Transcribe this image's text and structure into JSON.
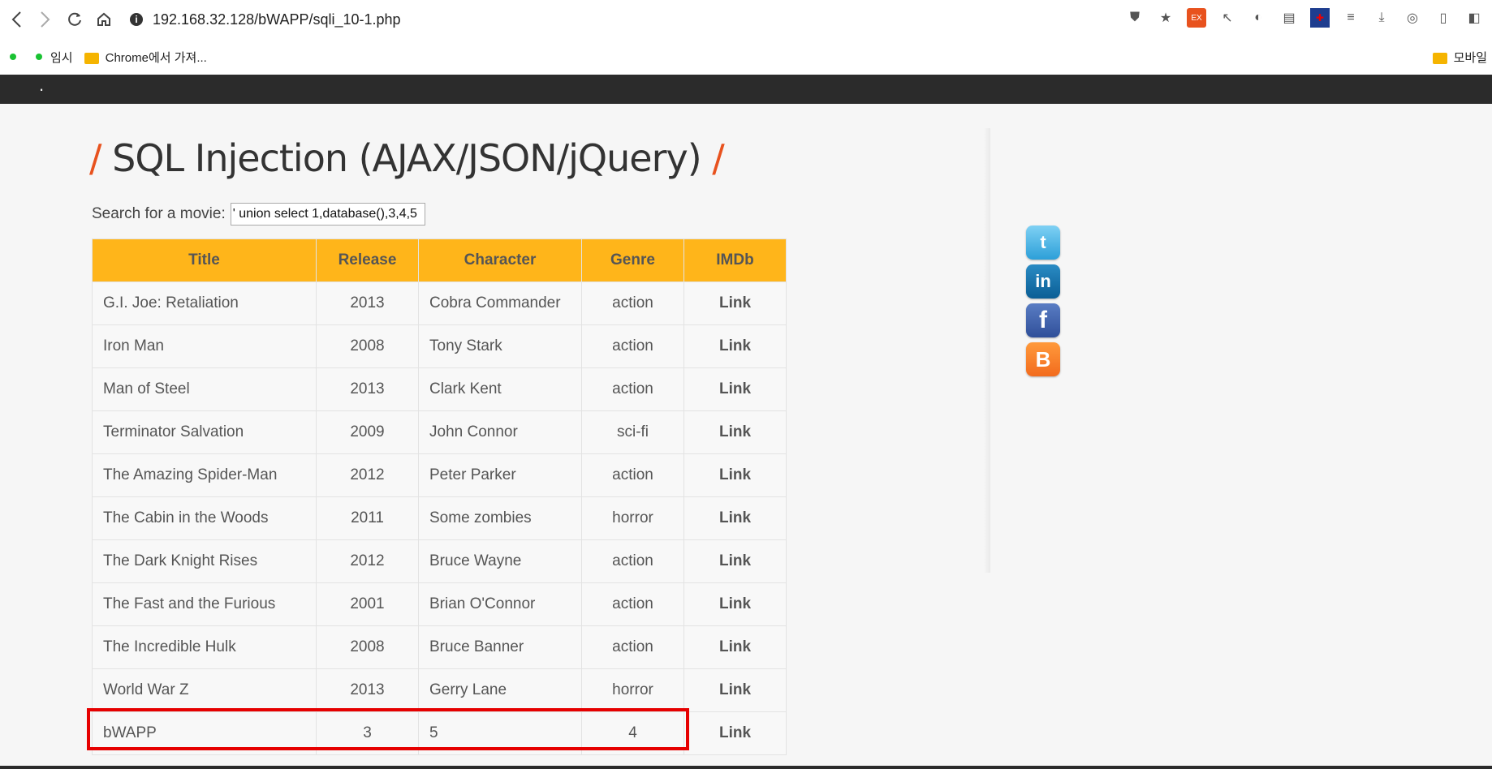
{
  "browser": {
    "url": "192.168.32.128/bWAPP/sqli_10-1.php",
    "bookmark_temp": "임시",
    "bookmark_chrome": "Chrome에서 가져...",
    "bookmark_mobile": "모바일"
  },
  "page": {
    "title": "SQL Injection (AJAX/JSON/jQuery)",
    "title_slash_left": "/",
    "title_slash_right": "/",
    "search_label": "Search for a movie:",
    "search_value": "' union select 1,database(),3,4,5"
  },
  "table": {
    "headers": [
      "Title",
      "Release",
      "Character",
      "Genre",
      "IMDb"
    ],
    "rows": [
      {
        "title": "G.I. Joe: Retaliation",
        "release": "2013",
        "character": "Cobra Commander",
        "genre": "action",
        "imdb": "Link"
      },
      {
        "title": "Iron Man",
        "release": "2008",
        "character": "Tony Stark",
        "genre": "action",
        "imdb": "Link"
      },
      {
        "title": "Man of Steel",
        "release": "2013",
        "character": "Clark Kent",
        "genre": "action",
        "imdb": "Link"
      },
      {
        "title": "Terminator Salvation",
        "release": "2009",
        "character": "John Connor",
        "genre": "sci-fi",
        "imdb": "Link"
      },
      {
        "title": "The Amazing Spider-Man",
        "release": "2012",
        "character": "Peter Parker",
        "genre": "action",
        "imdb": "Link"
      },
      {
        "title": "The Cabin in the Woods",
        "release": "2011",
        "character": "Some zombies",
        "genre": "horror",
        "imdb": "Link"
      },
      {
        "title": "The Dark Knight Rises",
        "release": "2012",
        "character": "Bruce Wayne",
        "genre": "action",
        "imdb": "Link"
      },
      {
        "title": "The Fast and the Furious",
        "release": "2001",
        "character": "Brian O'Connor",
        "genre": "action",
        "imdb": "Link"
      },
      {
        "title": "The Incredible Hulk",
        "release": "2008",
        "character": "Bruce Banner",
        "genre": "action",
        "imdb": "Link"
      },
      {
        "title": "World War Z",
        "release": "2013",
        "character": "Gerry Lane",
        "genre": "horror",
        "imdb": "Link"
      },
      {
        "title": "bWAPP",
        "release": "3",
        "character": "5",
        "genre": "4",
        "imdb": "Link"
      }
    ]
  },
  "social": {
    "twitter": "t",
    "linkedin": "in",
    "facebook": "f",
    "blogger": "B"
  },
  "colors": {
    "accent": "#ffb51a",
    "title_slash": "#e8521e",
    "highlight": "#e60000"
  }
}
